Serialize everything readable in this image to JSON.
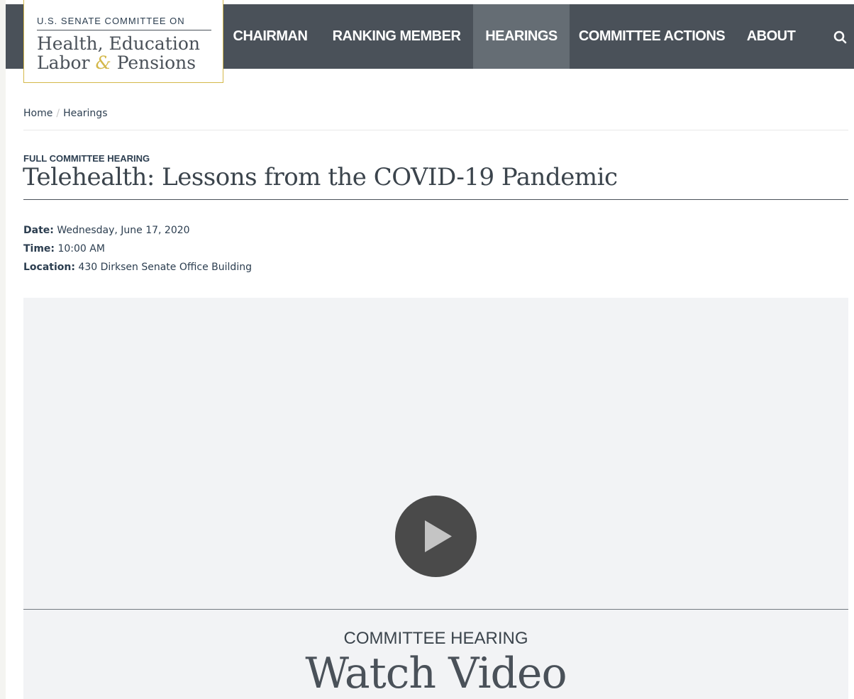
{
  "header": {
    "logo": {
      "top_line": "U.S. SENATE COMMITTEE ON",
      "line1": "Health, Education",
      "line2_a": "Labor",
      "line2_amp": "&",
      "line2_b": "Pensions"
    },
    "nav": [
      {
        "label": "CHAIRMAN",
        "active": false
      },
      {
        "label": "RANKING MEMBER",
        "active": false
      },
      {
        "label": "HEARINGS",
        "active": true
      },
      {
        "label": "COMMITTEE ACTIONS",
        "active": false
      },
      {
        "label": "ABOUT",
        "active": false
      }
    ],
    "search_icon": "search-icon"
  },
  "breadcrumb": {
    "items": [
      "Home",
      "Hearings"
    ],
    "separator": "/"
  },
  "hearing": {
    "type": "FULL COMMITTEE HEARING",
    "title": "Telehealth: Lessons from the COVID-19 Pandemic",
    "date_label": "Date:",
    "date_value": "Wednesday, June 17, 2020",
    "time_label": "Time:",
    "time_value": "10:00 AM",
    "location_label": "Location:",
    "location_value": "430 Dirksen Senate Office Building"
  },
  "video": {
    "play_icon": "play-icon",
    "eyebrow": "COMMITTEE HEARING",
    "title": "Watch Video"
  },
  "colors": {
    "nav_bg": "#4a5159",
    "nav_active_bg": "#656d74",
    "accent_gold": "#d4b84a",
    "text_dark": "#2c3e50",
    "video_bg": "#f2f3f5"
  }
}
